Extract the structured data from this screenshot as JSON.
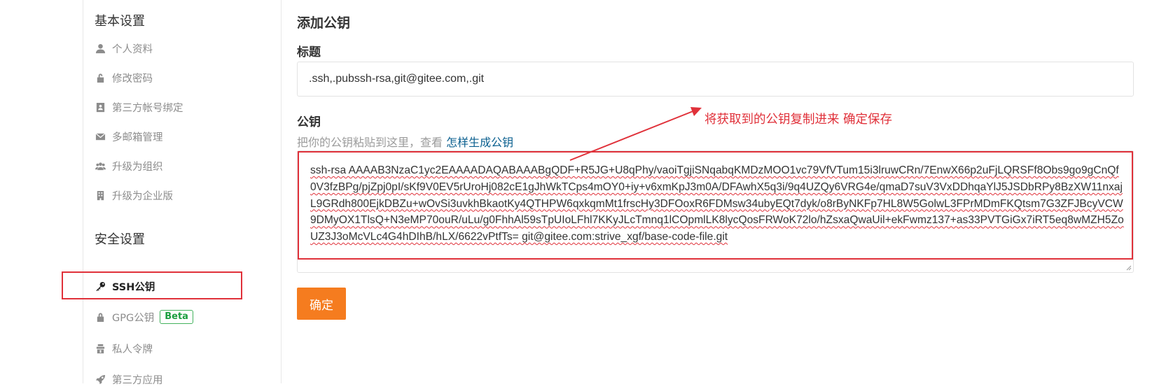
{
  "sidebar": {
    "basic_section": "基本设置",
    "basic_items": [
      {
        "label": "个人资料",
        "icon": "user-icon"
      },
      {
        "label": "修改密码",
        "icon": "unlock-icon"
      },
      {
        "label": "第三方帐号绑定",
        "icon": "contact-card-icon"
      },
      {
        "label": "多邮箱管理",
        "icon": "envelope-icon"
      },
      {
        "label": "升级为组织",
        "icon": "users-icon"
      },
      {
        "label": "升级为企业版",
        "icon": "building-icon"
      }
    ],
    "security_section": "安全设置",
    "security_items": [
      {
        "label": "SSH公钥",
        "icon": "key-icon",
        "active": true
      },
      {
        "label": "GPG公钥",
        "icon": "lock-icon",
        "badge": "Beta"
      },
      {
        "label": "私人令牌",
        "icon": "token-icon"
      },
      {
        "label": "第三方应用",
        "icon": "rocket-icon"
      }
    ]
  },
  "main": {
    "heading": "添加公钥",
    "title_label": "标题",
    "title_value": ".ssh,.pubssh-rsa,git@gitee.com,.git",
    "key_label": "公钥",
    "hint_prefix": "把你的公钥粘贴到这里，查看 ",
    "hint_link": "怎样生成公钥",
    "key_value": "ssh-rsa AAAAB3NzaC1yc2EAAAADAQABAAABgQDF+R5JG+U8qPhy/vaoiTgjiSNqabqKMDzMOO1vc79VfVTum15i3lruwCRn/7EnwX66p2uFjLQRSFf8Obs9go9gCnQf0V3fzBPg/pjZpj0pI/sKf9V0EV5rUroHj082cE1gJhWkTCps4mOY0+iy+v6xmKpJ3m0A/DFAwhX5q3i/9q4UZQy6VRG4e/qmaD7suV3VxDDhqaYlJ5JSDbRPy8BzXW11nxajL9GRdh800EjkDBZu+wOvSi3uvkhBkaotKy4QTHPW6qxkqmMt1frscHy3DFOoxR6FDMsw34ubyEQt7dyk/o8rByNKFp7HL8W5GolwL3FPrMDmFKQtsm7G3ZFJBcyVCW9DMyOX1TlsQ+N3eMP70ouR/uLu/g0FhhAl59sTpUIoLFhl7KKyJLcTmnq1lCOpmlLK8lycQosFRWoK72lo/hZsxaQwaUil+ekFwmz137+as33PVTGiGx7iRT5eq8wMZH5ZoUZ3J3oMcVLc4G4hDIhB/hLX/6622vPtfTs= git@gitee.com:strive_xgf/base-code-file.git",
    "annotation": "将获取到的公钥复制进来 确定保存",
    "confirm_label": "确定"
  },
  "colors": {
    "accent_orange": "#f57c1f",
    "annotation_red": "#e0313a",
    "beta_green": "#1b9e3f",
    "link_blue": "#0a5f8f"
  }
}
